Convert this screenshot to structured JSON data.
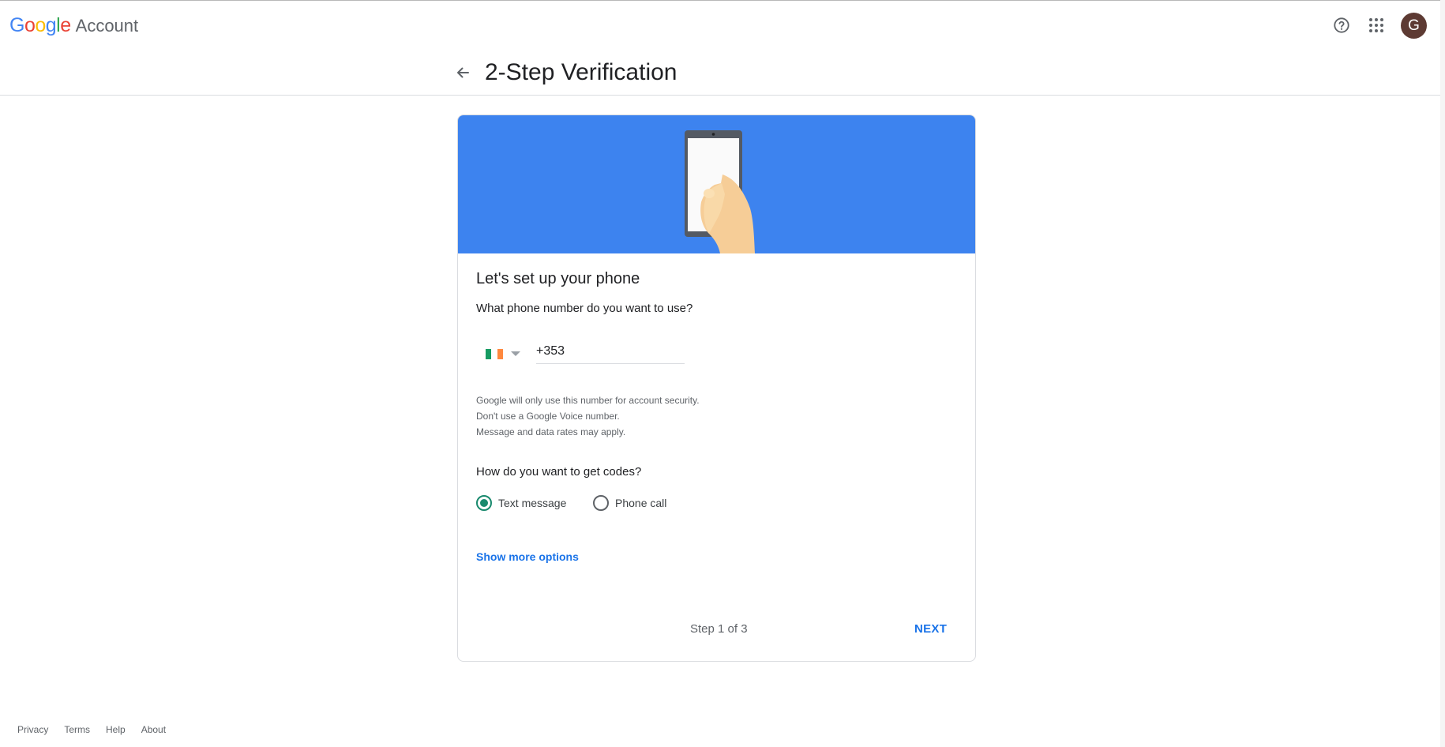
{
  "header": {
    "logo_letters": [
      {
        "ch": "G",
        "color": "#4285F4"
      },
      {
        "ch": "o",
        "color": "#EA4335"
      },
      {
        "ch": "o",
        "color": "#FBBC05"
      },
      {
        "ch": "g",
        "color": "#4285F4"
      },
      {
        "ch": "l",
        "color": "#34A853"
      },
      {
        "ch": "e",
        "color": "#EA4335"
      }
    ],
    "account_label": "Account",
    "help_icon": "help-circle-icon",
    "apps_icon": "apps-grid-icon",
    "avatar_initial": "G",
    "avatar_color": "#5d3a33"
  },
  "page": {
    "title": "2-Step Verification",
    "back_icon": "arrow-back-icon"
  },
  "card": {
    "banner_color": "#3d83ef",
    "heading": "Let's set up your phone",
    "phone_question": "What phone number do you want to use?",
    "country_flag": "ireland-flag-icon",
    "flag_colors": [
      "#169b62",
      "#ffffff",
      "#ff883e"
    ],
    "phone_value": "+353",
    "notes": [
      "Google will only use this number for account security.",
      "Don't use a Google Voice number.",
      "Message and data rates may apply."
    ],
    "codes_question": "How do you want to get codes?",
    "options": [
      {
        "label": "Text message",
        "checked": true
      },
      {
        "label": "Phone call",
        "checked": false
      }
    ],
    "show_more": "Show more options",
    "step_text": "Step 1 of 3",
    "next_label": "NEXT"
  },
  "footer": {
    "links": [
      "Privacy",
      "Terms",
      "Help",
      "About"
    ]
  }
}
